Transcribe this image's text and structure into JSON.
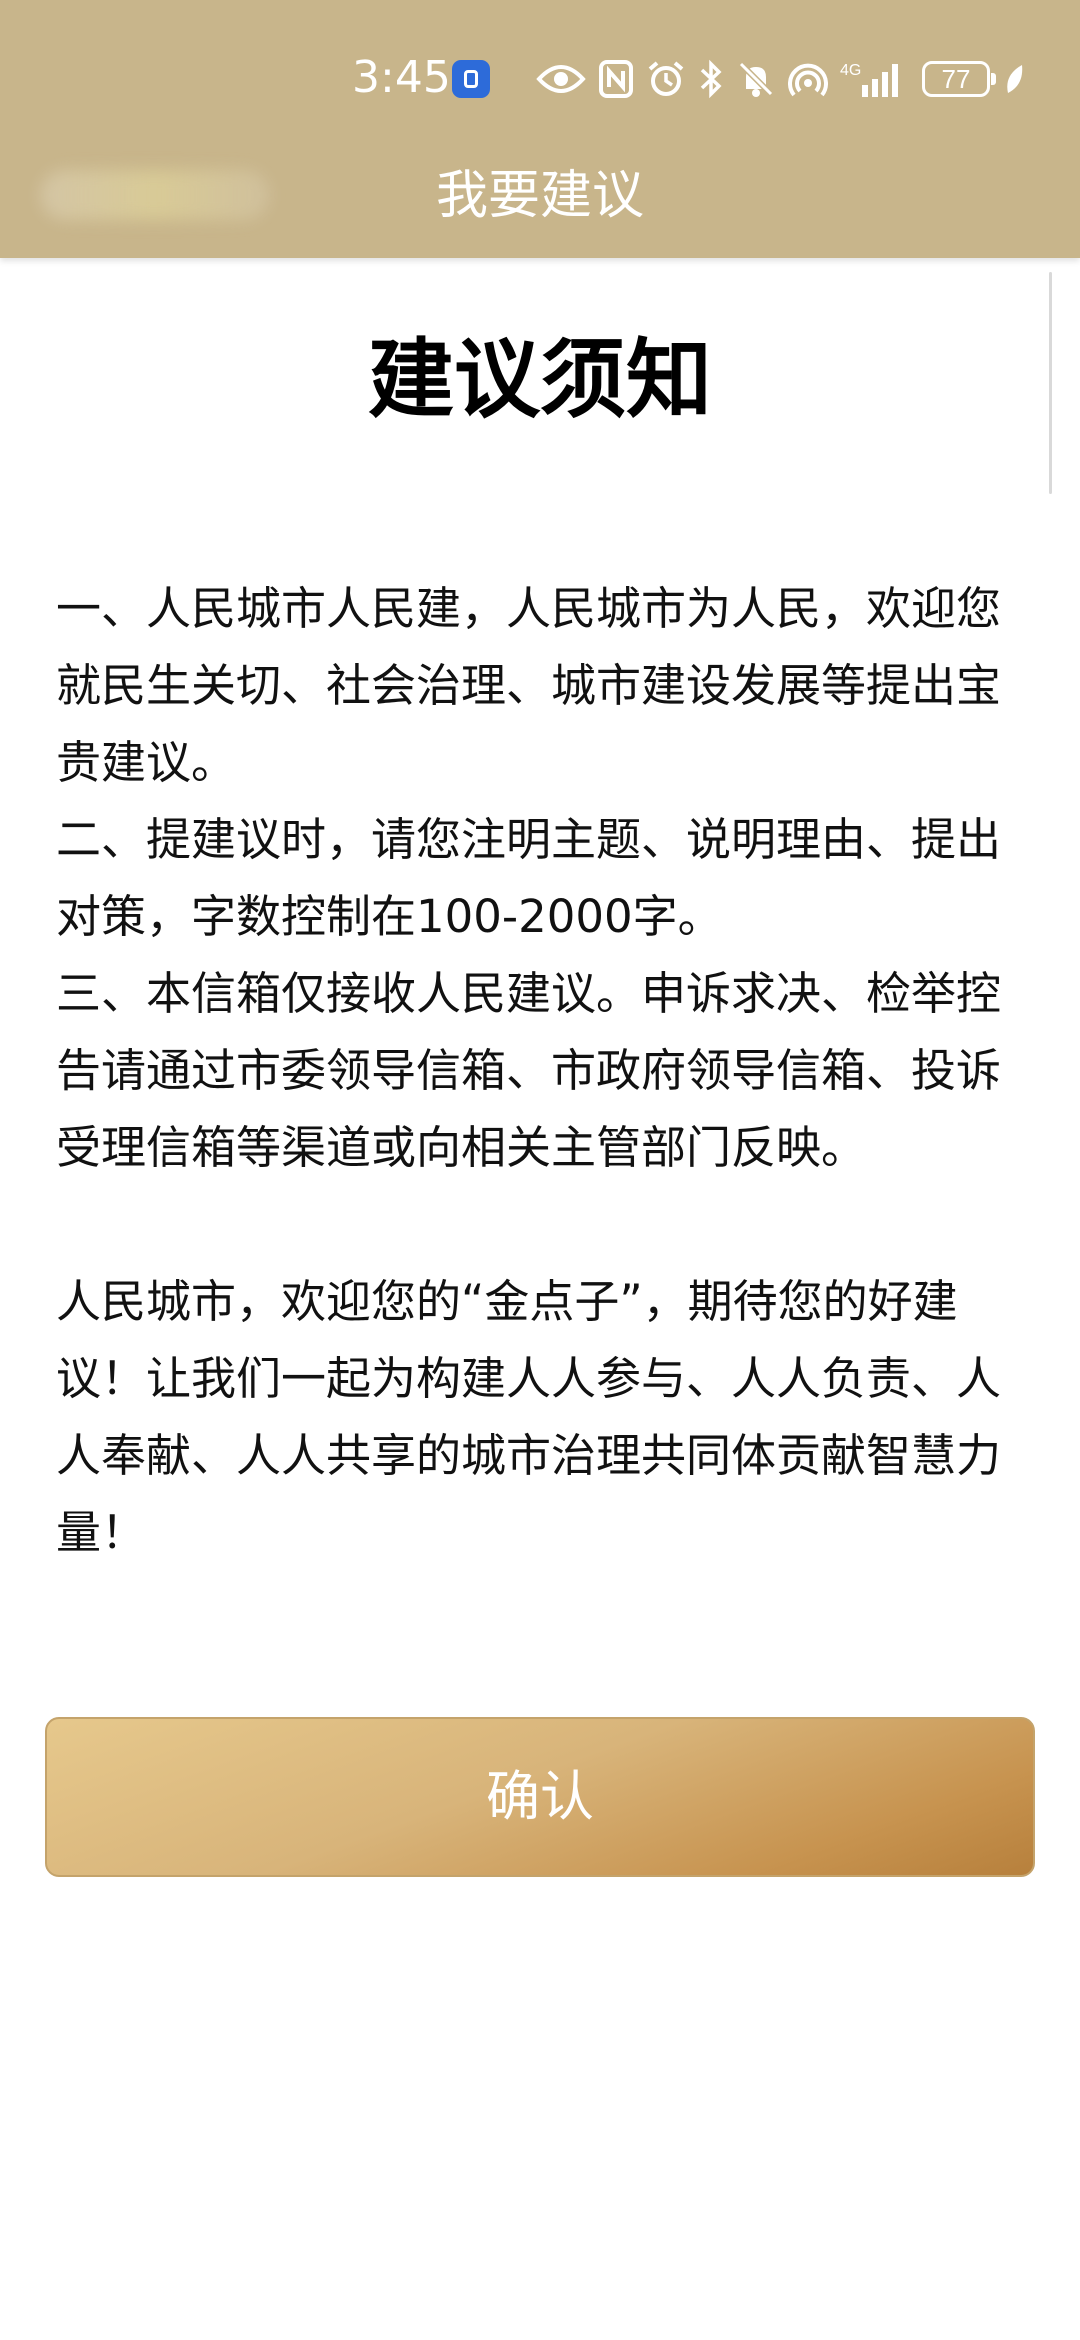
{
  "status_bar": {
    "time": "3:45",
    "battery": "77",
    "network": "4G"
  },
  "header": {
    "title": "我要建议"
  },
  "notice": {
    "heading": "建议须知",
    "paragraphs": [
      "一、人民城市人民建，人民城市为人民，欢迎您就民生关切、社会治理、城市建设发展等提出宝贵建议。",
      "二、提建议时，请您注明主题、说明理由、提出对策，字数控制在100-2000字。",
      "三、本信箱仅接收人民建议。申诉求决、检举控告请通过市委领导信箱、市政府领导信箱、投诉受理信箱等渠道或向相关主管部门反映。"
    ],
    "closing": "人民城市，欢迎您的“金点子”，期待您的好建议！让我们一起为构建人人参与、人人负责、人人奉献、人人共享的城市治理共同体贡献智慧力量！"
  },
  "confirm_button": {
    "label": "确认"
  },
  "colors": {
    "header_bg": "#c8b58b",
    "button_gradient_start": "#e6c88c",
    "button_gradient_end": "#b7803c"
  }
}
